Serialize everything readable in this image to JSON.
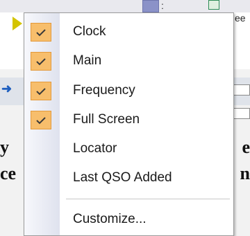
{
  "menu": {
    "items": [
      {
        "label": "Clock",
        "checked": true
      },
      {
        "label": "Main",
        "checked": true
      },
      {
        "label": "Frequency",
        "checked": true
      },
      {
        "label": "Full Screen",
        "checked": true
      },
      {
        "label": "Locator",
        "checked": false
      },
      {
        "label": "Last QSO Added",
        "checked": false
      }
    ],
    "customize_label": "Customize..."
  },
  "background": {
    "left_fragments": [
      "y",
      "ce"
    ],
    "right_fragments": [
      "e",
      "n",
      "ee"
    ],
    "top_glyph": ":"
  },
  "colors": {
    "check_fill": "#f7be6c",
    "check_border": "#e3993a",
    "check_mark": "#3a3a3a"
  }
}
